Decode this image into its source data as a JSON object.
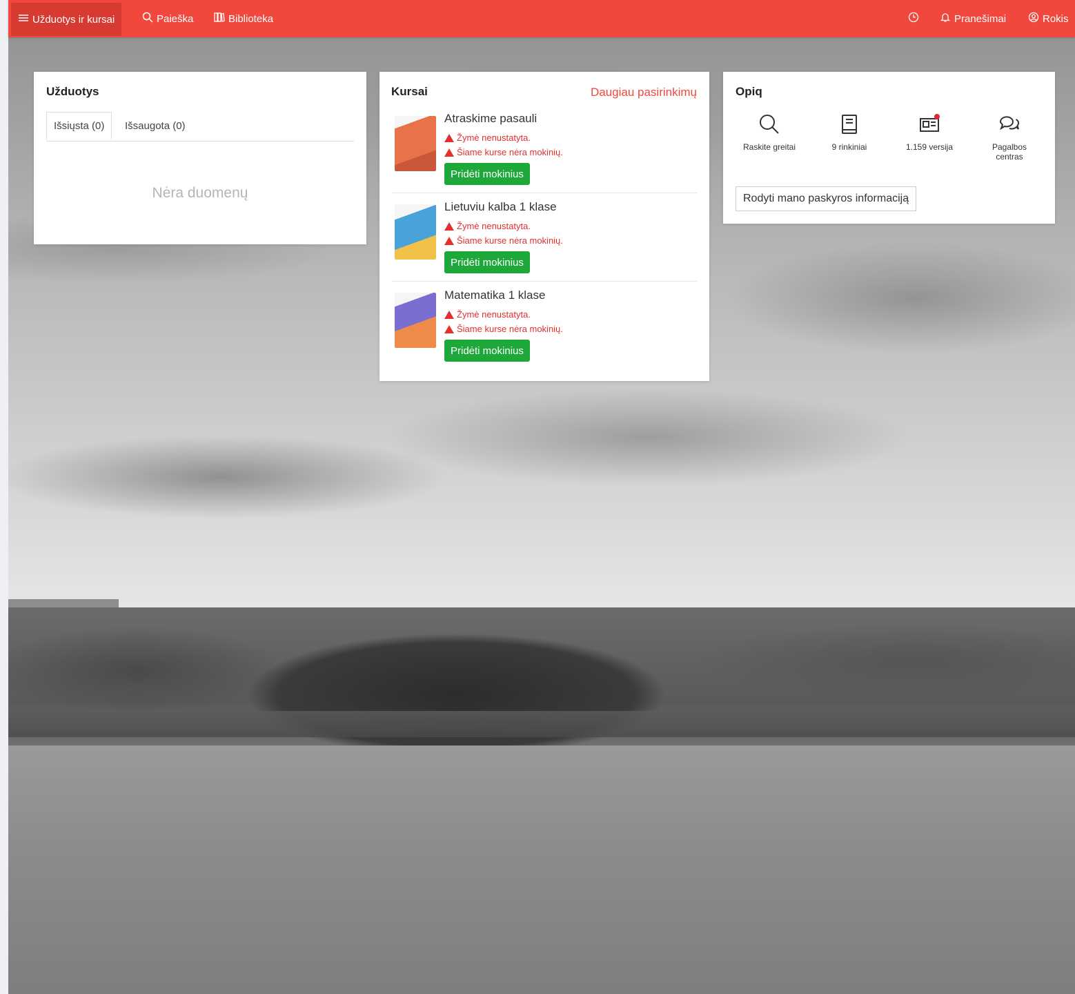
{
  "topbar": {
    "tasks_label": "Užduotys ir kursai",
    "search_label": "Paieška",
    "library_label": "Biblioteka",
    "notifications_label": "Pranešimai",
    "user_label": "Rokis"
  },
  "tasks_card": {
    "title": "Užduotys",
    "tabs": [
      "Išsiųsta (0)",
      "Išsaugota (0)"
    ],
    "empty_text": "Nėra duomenų"
  },
  "courses_card": {
    "title": "Kursai",
    "more_link": "Daugiau pasirinkimų",
    "courses": [
      {
        "title": "Atraskime pasauli",
        "warning_mark": "Žymė nenustatyta.",
        "warning_students": "Šiame kurse nėra mokinių.",
        "button": "Pridėti mokinius",
        "cover_color": "#e8724a"
      },
      {
        "title": "Lietuviu kalba 1 klase",
        "warning_mark": "Žymė nenustatyta.",
        "warning_students": "Šiame kurse nėra mokinių.",
        "button": "Pridėti mokinius",
        "cover_color": "#4aa3d8"
      },
      {
        "title": "Matematika 1 klase",
        "warning_mark": "Žymė nenustatyta.",
        "warning_students": "Šiame kurse nėra mokinių.",
        "button": "Pridėti mokinius",
        "cover_color": "#7a6fd0"
      }
    ]
  },
  "opiq_card": {
    "title": "Opiq",
    "quick_links": [
      {
        "label": "Raskite greitai",
        "icon": "search-icon"
      },
      {
        "label": "9 rinkiniai",
        "icon": "book-icon"
      },
      {
        "label": "1.159 versija",
        "icon": "news-icon"
      },
      {
        "label": "Pagalbos centras",
        "icon": "chat-icon"
      }
    ],
    "account_button": "Rodyti mano paskyros informaciją"
  },
  "colors": {
    "brand": "#f2473d",
    "success": "#1fa83a",
    "warning": "#e03030"
  }
}
